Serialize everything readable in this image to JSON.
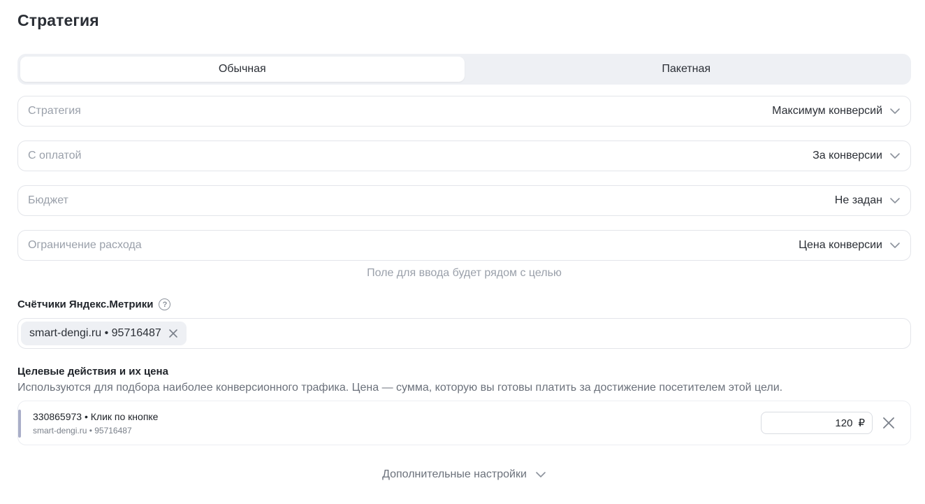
{
  "page": {
    "title": "Стратегия"
  },
  "mode_switch": {
    "options": [
      "Обычная",
      "Пакетная"
    ],
    "active": "Обычная"
  },
  "selects": [
    {
      "label": "Стратегия",
      "value": "Максимум конверсий"
    },
    {
      "label": "С оплатой",
      "value": "За конверсии"
    },
    {
      "label": "Бюджет",
      "value": "Не задан"
    },
    {
      "label": "Ограничение расхода",
      "value": "Цена конверсии"
    }
  ],
  "hint": "Поле для ввода будет рядом с целью",
  "counters": {
    "label": "Счётчики Яндекс.Метрики",
    "chip": "smart-dengi.ru • 95716487"
  },
  "goals": {
    "label": "Целевые действия и их цена",
    "description": "Используются для подбора наиболее конверсионного трафика. Цена — сумма, которую вы готовы платить за достижение посетителем этой цели.",
    "items": [
      {
        "title": "330865973 • Клик по кнопке",
        "subtitle": "smart-dengi.ru • 95716487",
        "price": "120",
        "currency": "₽"
      }
    ]
  },
  "more_settings": "Дополнительные настройки",
  "colors": {
    "accent_bar": "#a9aec8",
    "border": "#e3e5ea",
    "switch_bg": "#eef0f4"
  }
}
